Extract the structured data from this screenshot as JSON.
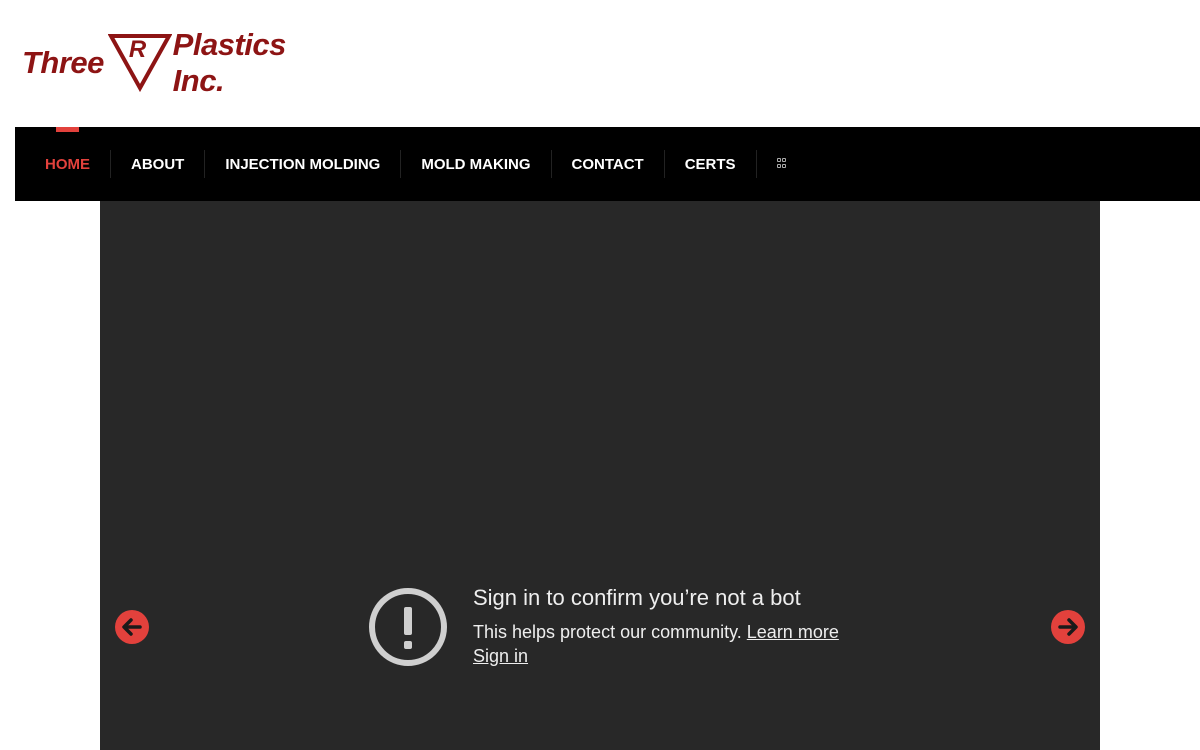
{
  "brand": {
    "name_part_a": "Three",
    "name_part_r": "R",
    "name_part_b": "Plastics Inc.",
    "color": "#8d1414"
  },
  "nav": {
    "items": [
      {
        "label": "HOME",
        "active": true
      },
      {
        "label": "ABOUT",
        "active": false
      },
      {
        "label": "INJECTION MOLDING",
        "active": false
      },
      {
        "label": "MOLD MAKING",
        "active": false
      },
      {
        "label": "CONTACT",
        "active": false
      },
      {
        "label": "CERTS",
        "active": false
      }
    ],
    "grid_icon": "grid-icon",
    "active_color": "#e2413c",
    "background": "#000000"
  },
  "slider": {
    "background": "#282828",
    "prev_icon": "arrow-left-icon",
    "next_icon": "arrow-right-icon",
    "arrow_color": "#e2413c"
  },
  "bot_notice": {
    "icon": "exclamation-circle-icon",
    "title": "Sign in to confirm you’re not a bot",
    "body": "This helps protect our community.",
    "learn_more": "Learn more",
    "sign_in": "Sign in"
  }
}
